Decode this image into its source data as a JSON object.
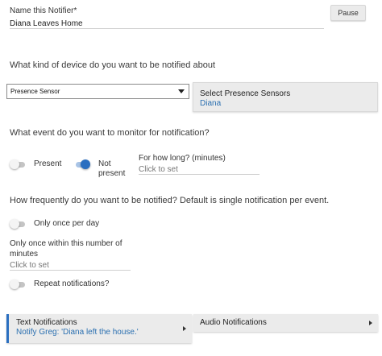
{
  "name_field": {
    "label": "Name this Notifier*",
    "value": "Diana Leaves Home"
  },
  "pause_button": {
    "label": "Pause"
  },
  "device_question": "What kind of device do you want to be notified about",
  "device_select": {
    "selected": "Presence Sensor"
  },
  "presence_panel": {
    "title": "Select Presence Sensors",
    "selected": "Diana"
  },
  "event_question": "What event do you want to monitor for notification?",
  "present_toggle": {
    "label": "Present",
    "state": "off"
  },
  "not_present_toggle": {
    "label_line1": "Not",
    "label_line2": "present",
    "state": "on",
    "accent": "#2b6fc0"
  },
  "how_long": {
    "label": "For how long? (minutes)",
    "placeholder": "Click to set"
  },
  "frequency_question": "How frequently do you want to be notified?  Default is single notification per event.",
  "once_per_day": {
    "label": "Only once per day",
    "state": "off"
  },
  "once_within": {
    "label_line1": "Only once within this number of",
    "label_line2": "minutes",
    "placeholder": "Click to set"
  },
  "repeat": {
    "label": "Repeat notifications?",
    "state": "off"
  },
  "text_notifications": {
    "title": "Text Notifications",
    "subtitle": "Notify Greg: 'Diana left the house.'"
  },
  "audio_notifications": {
    "title": "Audio Notifications"
  }
}
